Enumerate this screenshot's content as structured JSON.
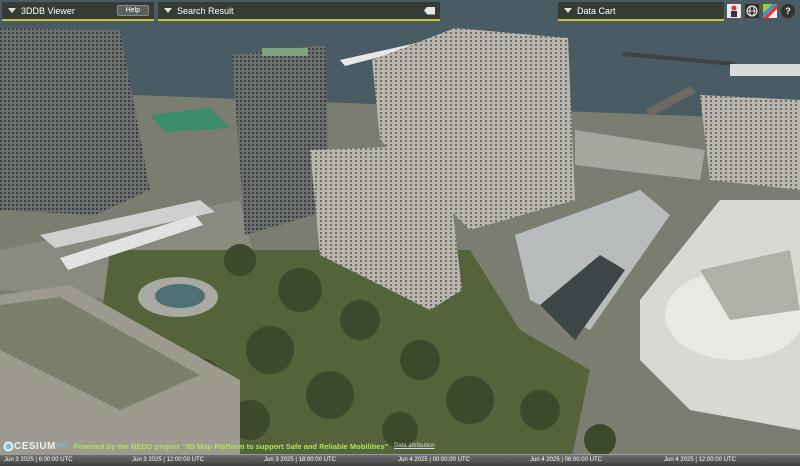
{
  "viewer_panel": {
    "title": "3DDB Viewer",
    "help_label": "Help"
  },
  "search_panel": {
    "title": "Search Result"
  },
  "cart_panel": {
    "title": "Data Cart"
  },
  "toolbar": {
    "help_glyph": "?"
  },
  "footer": {
    "logo_text": "CESIUM",
    "logo_suffix": "ion",
    "powered_by": "Powered by the NEDO project \"3D Map Platform to support Safe and Reliable Mobilities\"",
    "attribution_label": "Data attribution"
  },
  "timeline": {
    "ticks": [
      "Jun 3 2025 | 6:00:00 UTC",
      "Jun 3 2025 | 12:00:00 UTC",
      "Jun 3 2025 | 18:00:00 UTC",
      "Jun 4 2025 | 00:00:00 UTC",
      "Jun 4 2025 | 06:00:00 UTC",
      "Jun 4 2025 | 12:00:00 UTC",
      "Jun 4 2025 | 18:00:00 UTC"
    ]
  }
}
